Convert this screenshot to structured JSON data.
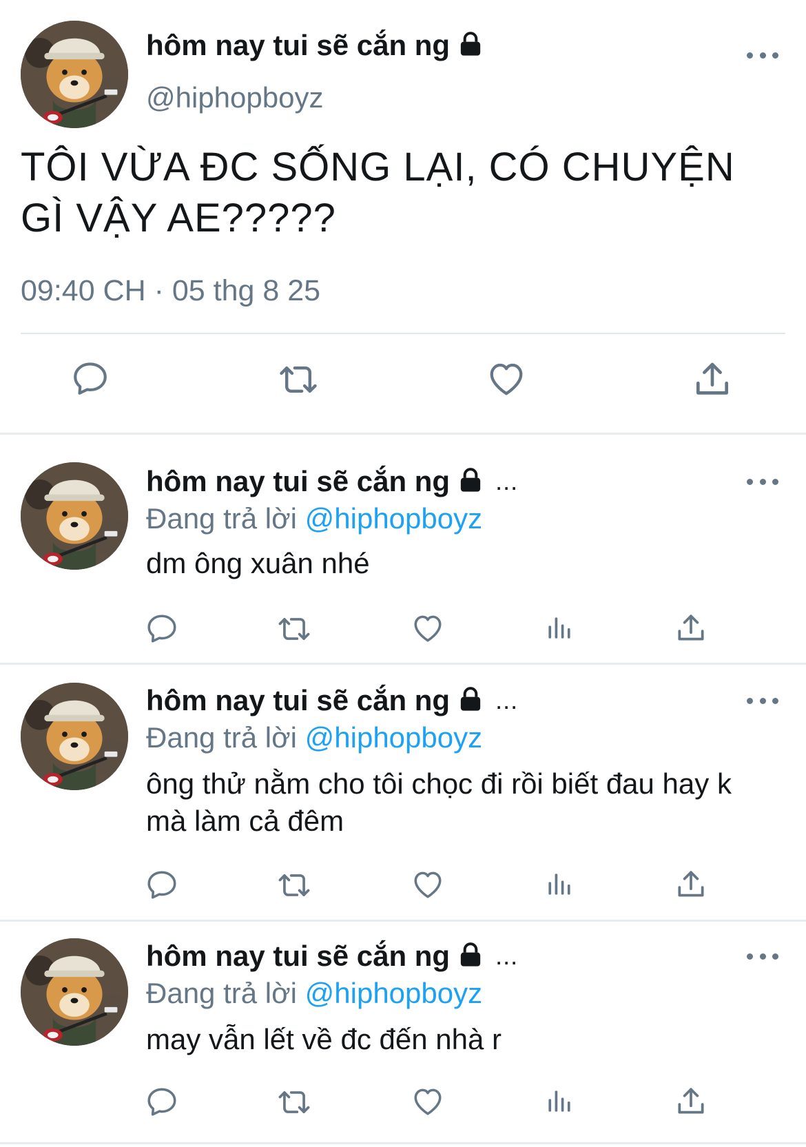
{
  "main_tweet": {
    "display_name": "hôm nay tui sẽ cắn ng",
    "handle": "@hiphopboyz",
    "text": "TÔI VỪA ĐC SỐNG LẠI, CÓ CHUYỆN GÌ VẬY AE?????",
    "meta": "09:40 CH · 05 thg 8 25",
    "actions": [
      "reply-icon",
      "retweet-icon",
      "like-icon",
      "share-icon"
    ]
  },
  "replies": [
    {
      "display_name": "hôm nay tui sẽ cắn ng",
      "ellipsis": "...",
      "replying_prefix": "Đang trả lời",
      "replying_handle": "@hiphopboyz",
      "text": "dm ông xuân nhé"
    },
    {
      "display_name": "hôm nay tui sẽ cắn ng",
      "ellipsis": "...",
      "replying_prefix": "Đang trả lời",
      "replying_handle": "@hiphopboyz",
      "text": "ông thử nằm cho tôi chọc đi rồi biết đau hay k mà làm cả đêm"
    },
    {
      "display_name": "hôm nay tui sẽ cắn ng",
      "ellipsis": "...",
      "replying_prefix": "Đang trả lời",
      "replying_handle": "@hiphopboyz",
      "text": "may vẫn lết về đc đến nhà r"
    }
  ],
  "reply_actions": [
    "reply-icon",
    "retweet-icon",
    "like-icon",
    "analytics-icon",
    "share-icon"
  ],
  "colors": {
    "text": "#14171a",
    "secondary": "#657786",
    "link": "#1da1f2",
    "divider": "#e1e8ed"
  }
}
